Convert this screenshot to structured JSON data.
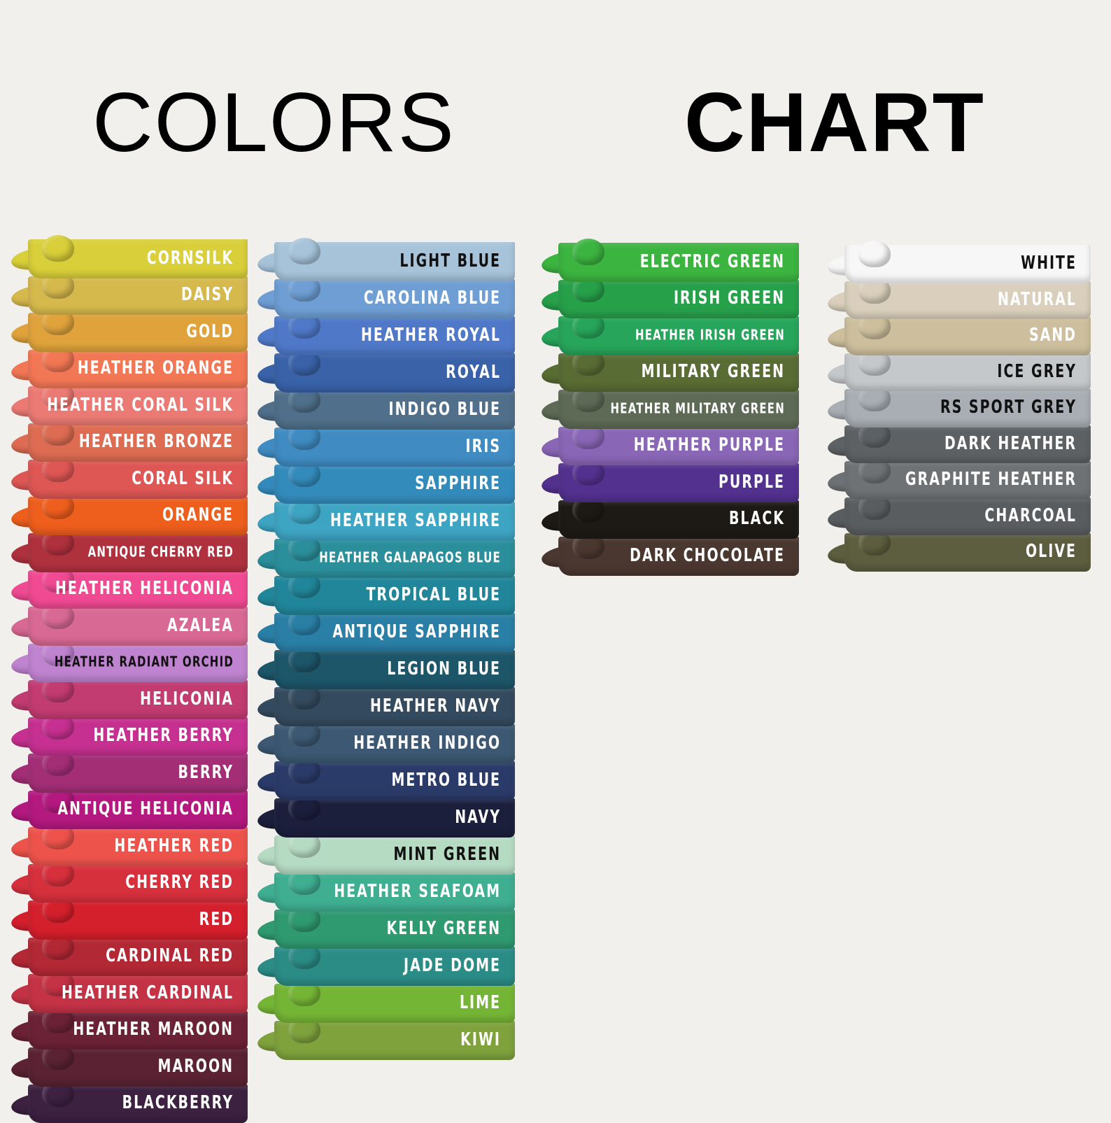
{
  "titles": {
    "left": "COLORS",
    "right": "CHART"
  },
  "columns": [
    {
      "swatches": [
        {
          "label": "CORNSILK",
          "color": "#d9cf3a"
        },
        {
          "label": "DAISY",
          "color": "#d6b94d"
        },
        {
          "label": "GOLD",
          "color": "#e0a33c"
        },
        {
          "label": "HEATHER ORANGE",
          "color": "#f27755"
        },
        {
          "label": "HEATHER CORAL SILK",
          "color": "#ec7a74"
        },
        {
          "label": "HEATHER BRONZE",
          "color": "#dd6c52"
        },
        {
          "label": "CORAL SILK",
          "color": "#de5754"
        },
        {
          "label": "ORANGE",
          "color": "#ee5e1d"
        },
        {
          "label": "ANTIQUE CHERRY RED",
          "color": "#b0313e",
          "small": true
        },
        {
          "label": "HEATHER HELICONIA",
          "color": "#f04a93"
        },
        {
          "label": "AZALEA",
          "color": "#d86994"
        },
        {
          "label": "HEATHER RADIANT ORCHID",
          "color": "#bf83cf",
          "small": true,
          "dark": true
        },
        {
          "label": "HELICONIA",
          "color": "#c23b71"
        },
        {
          "label": "HEATHER BERRY",
          "color": "#c63090"
        },
        {
          "label": "BERRY",
          "color": "#a32e76"
        },
        {
          "label": "ANTIQUE HELICONIA",
          "color": "#b3197f"
        },
        {
          "label": "HEATHER RED",
          "color": "#ed534b"
        },
        {
          "label": "CHERRY RED",
          "color": "#d7303d"
        },
        {
          "label": "RED",
          "color": "#d41f2c"
        },
        {
          "label": "CARDINAL RED",
          "color": "#b32835"
        },
        {
          "label": "HEATHER CARDINAL",
          "color": "#c43245"
        },
        {
          "label": "HEATHER MAROON",
          "color": "#6c2236"
        },
        {
          "label": "MAROON",
          "color": "#5a2233"
        },
        {
          "label": "BLACKBERRY",
          "color": "#3c2141"
        }
      ]
    },
    {
      "swatches": [
        {
          "label": "LIGHT BLUE",
          "color": "#a6c3d9",
          "dark": true
        },
        {
          "label": "CAROLINA BLUE",
          "color": "#6e9ed4"
        },
        {
          "label": "HEATHER ROYAL",
          "color": "#4f79c8"
        },
        {
          "label": "ROYAL",
          "color": "#3962a9"
        },
        {
          "label": "INDIGO BLUE",
          "color": "#4f6f8a"
        },
        {
          "label": "IRIS",
          "color": "#3f8bc2"
        },
        {
          "label": "SAPPHIRE",
          "color": "#338bbc"
        },
        {
          "label": "HEATHER SAPPHIRE",
          "color": "#3ea4c3"
        },
        {
          "label": "HEATHER GALAPAGOS BLUE",
          "color": "#2b8f9b",
          "small": true
        },
        {
          "label": "TROPICAL BLUE",
          "color": "#21869a"
        },
        {
          "label": "ANTIQUE SAPPHIRE",
          "color": "#2a7fa6"
        },
        {
          "label": "LEGION BLUE",
          "color": "#1d5569"
        },
        {
          "label": "HEATHER NAVY",
          "color": "#344a5e"
        },
        {
          "label": "HEATHER INDIGO",
          "color": "#3c5872"
        },
        {
          "label": "METRO BLUE",
          "color": "#2b3b69"
        },
        {
          "label": "NAVY",
          "color": "#1b1f3c"
        },
        {
          "label": "MINT GREEN",
          "color": "#b6dbc3",
          "dark": true
        },
        {
          "label": "HEATHER SEAFOAM",
          "color": "#3fae91"
        },
        {
          "label": "KELLY GREEN",
          "color": "#2f9a70"
        },
        {
          "label": "JADE DOME",
          "color": "#2b8c86"
        },
        {
          "label": "LIME",
          "color": "#75b536"
        },
        {
          "label": "KIWI",
          "color": "#7fa23d"
        }
      ]
    },
    {
      "swatches": [
        {
          "label": "ELECTRIC GREEN",
          "color": "#3cb440"
        },
        {
          "label": "IRISH GREEN",
          "color": "#27a04a"
        },
        {
          "label": "HEATHER IRISH GREEN",
          "color": "#27a55a",
          "small": true
        },
        {
          "label": "MILITARY GREEN",
          "color": "#596c34"
        },
        {
          "label": "HEATHER MILITARY GREEN",
          "color": "#5d6a56",
          "small": true
        },
        {
          "label": "HEATHER PURPLE",
          "color": "#8966b6"
        },
        {
          "label": "PURPLE",
          "color": "#53318f"
        },
        {
          "label": "BLACK",
          "color": "#1d1a16"
        },
        {
          "label": "DARK CHOCOLATE",
          "color": "#4a3730"
        }
      ]
    },
    {
      "swatches": [
        {
          "label": "WHITE",
          "color": "#f7f7f7",
          "dark": true
        },
        {
          "label": "NATURAL",
          "color": "#d9cfbc"
        },
        {
          "label": "SAND",
          "color": "#cdbf9d"
        },
        {
          "label": "ICE GREY",
          "color": "#c5c8ca",
          "dark": true
        },
        {
          "label": "RS SPORT GREY",
          "color": "#a8aeb3",
          "dark": true
        },
        {
          "label": "DARK HEATHER",
          "color": "#5d6164"
        },
        {
          "label": "GRAPHITE HEATHER",
          "color": "#6f7274"
        },
        {
          "label": "CHARCOAL",
          "color": "#5a5d60"
        },
        {
          "label": "OLIVE",
          "color": "#5d5e3f"
        }
      ]
    }
  ]
}
